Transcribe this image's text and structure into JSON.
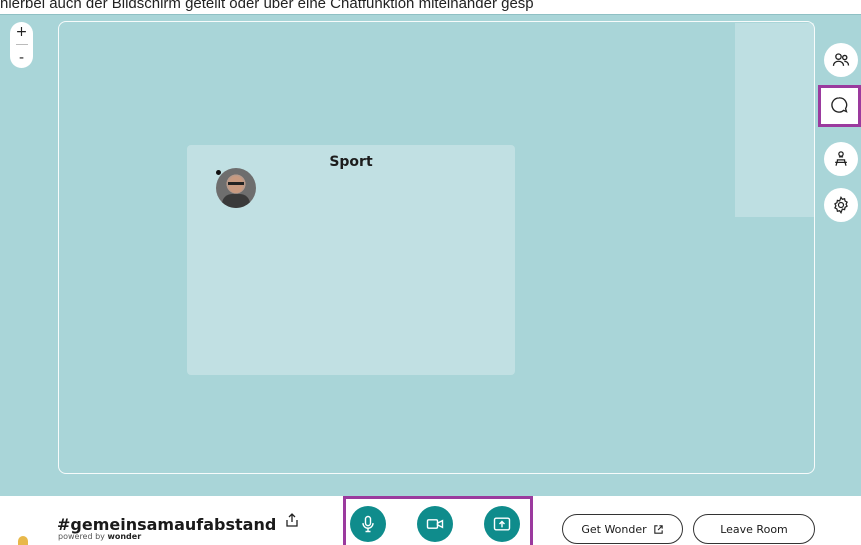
{
  "caption": "hierbei auch der Bildschirm geteilt oder über eine Chatfunktion miteinander gesp",
  "zoom": {
    "in_label": "+",
    "out_label": "-"
  },
  "room": {
    "title": "Sport"
  },
  "sidebar": {
    "buttons": [
      {
        "icon": "people-icon"
      },
      {
        "icon": "chat-icon"
      },
      {
        "icon": "broadcast-icon"
      },
      {
        "icon": "gear-icon"
      }
    ]
  },
  "footer": {
    "room_name": "#gemeinsamaufabstand",
    "powered_prefix": "powered by ",
    "powered_brand": "wonder",
    "get_wonder_label": "Get Wonder",
    "leave_room_label": "Leave Room"
  },
  "colors": {
    "background": "#a9d5d8",
    "accent": "#0f8c8c",
    "highlight": "#9b3a9e"
  }
}
